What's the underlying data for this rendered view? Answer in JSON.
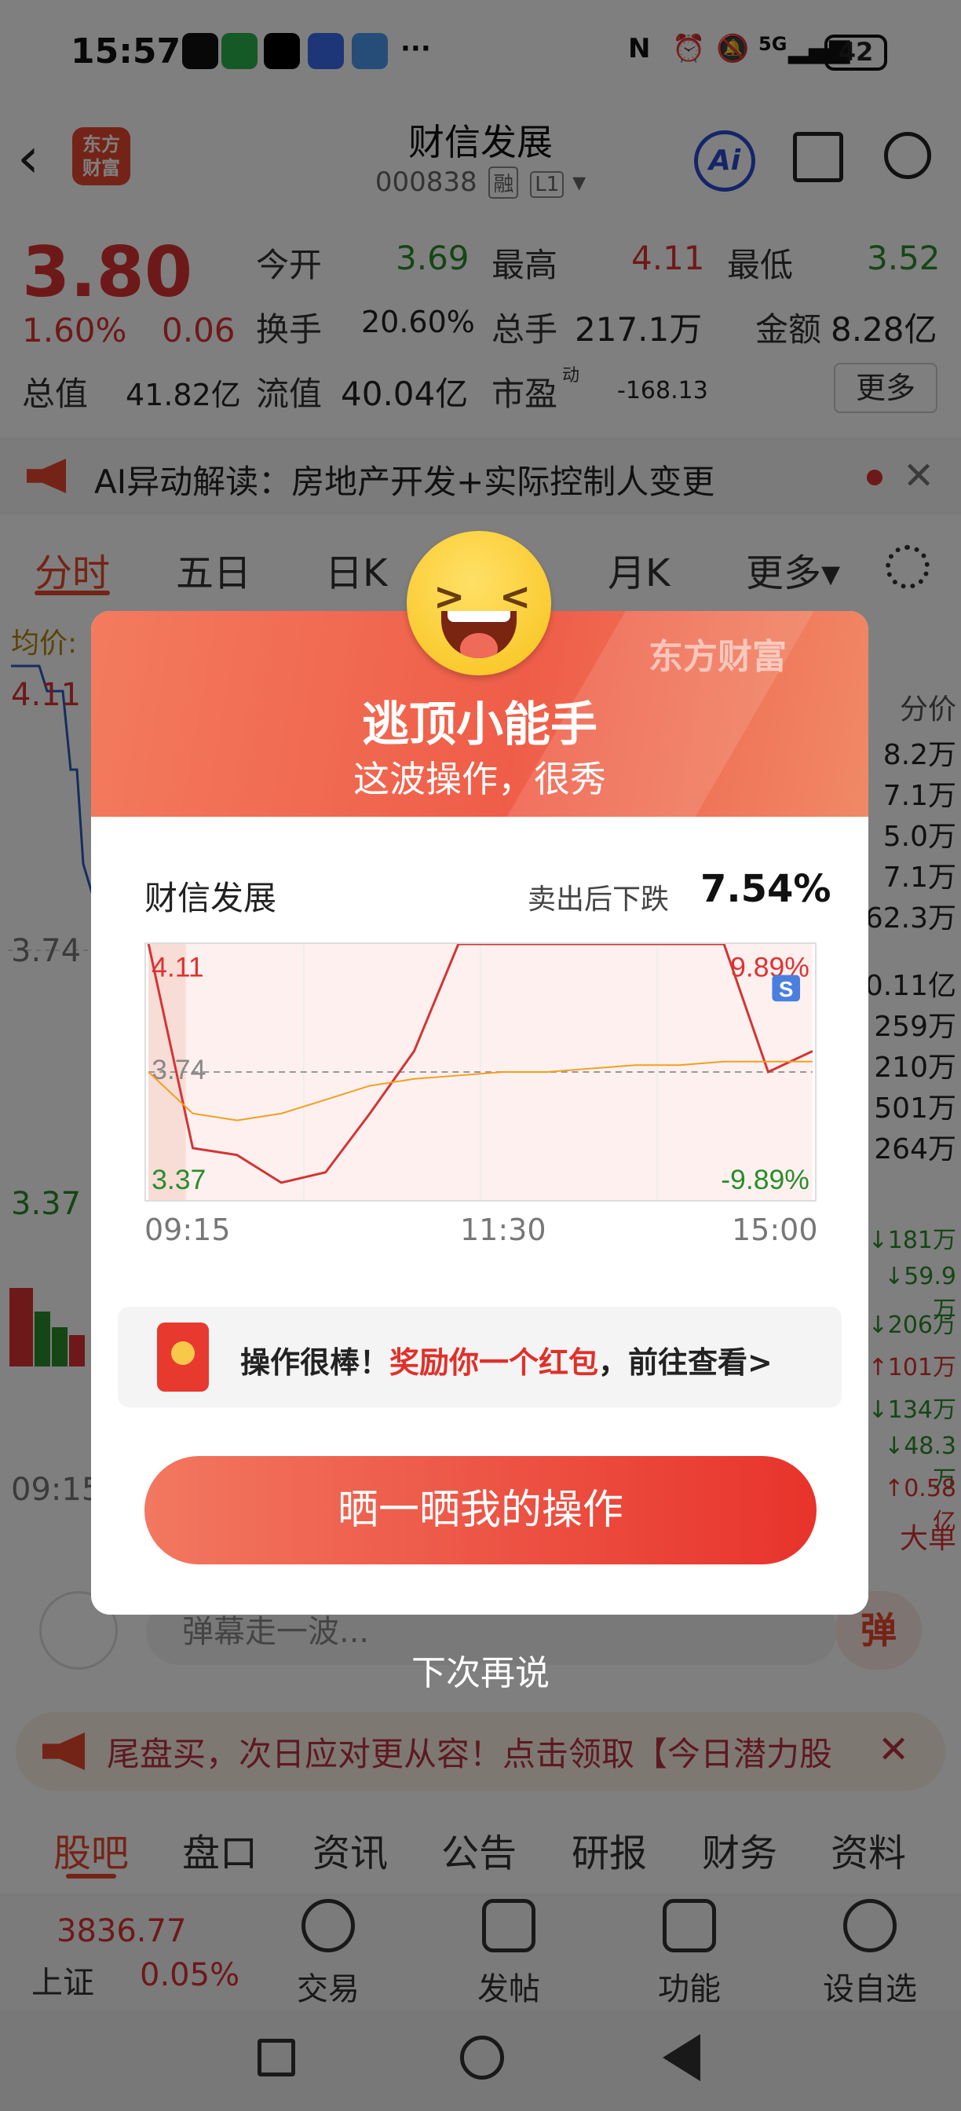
{
  "status_bar": {
    "time": "15:57",
    "network": "5G",
    "battery": "42"
  },
  "header": {
    "title": "财信发展",
    "code": "000838",
    "tags": [
      "融",
      "L1"
    ],
    "logo": "东方\n财富",
    "ai_label": "Ai"
  },
  "quote": {
    "price": "3.80",
    "pct": "1.60%",
    "change": "0.06",
    "open_label": "今开",
    "open": "3.69",
    "high_label": "最高",
    "high": "4.11",
    "low_label": "最低",
    "low": "3.52",
    "turnover_label": "换手",
    "turnover": "20.60%",
    "volume_label": "总手",
    "volume": "217.1万",
    "amount_label": "金额",
    "amount": "8.28亿",
    "mcap_label": "总值",
    "mcap": "41.82亿",
    "float_label": "流值",
    "float": "40.04亿",
    "pe_label": "市盈",
    "pe_sup": "动",
    "pe": "-168.13",
    "more": "更多"
  },
  "notice": {
    "text": "AI异动解读：房地产开发+实际控制人变更"
  },
  "chart_tabs": [
    "分时",
    "五日",
    "日K",
    "月K",
    "更多▾"
  ],
  "bg_chart": {
    "avg_label": "均价:",
    "y_top": "4.11",
    "y_mid": "3.74",
    "y_bottom": "3.37",
    "time_start": "09:15",
    "right_header": "分价",
    "right_values": [
      "8.2万",
      "7.1万",
      "5.0万",
      "7.1万",
      "62.3万",
      "0.11亿",
      "259万",
      "210万",
      "501万",
      "264万"
    ],
    "right_flows": [
      "↓181万",
      "↓59.9万",
      "↓206万",
      "↑101万",
      "↓134万",
      "↓48.3万",
      "↑0.58亿"
    ],
    "right_footer": "大单"
  },
  "comment": {
    "placeholder": "弹幕走一波...",
    "danmu": "弹"
  },
  "promo": {
    "text": "尾盘买，次日应对更从容！点击领取【今日潜力股"
  },
  "bottom_tabs": [
    "股吧",
    "盘口",
    "资讯",
    "公告",
    "研报",
    "财务",
    "资料"
  ],
  "toolbar": {
    "index_value": "3836.77",
    "index_name": "上证",
    "index_pct": "0.05%",
    "items": [
      "交易",
      "发帖",
      "功能",
      "设自选"
    ]
  },
  "modal": {
    "brand": "东方财富",
    "title": "逃顶小能手",
    "subtitle": "这波操作，很秀",
    "stock_name": "财信发展",
    "drop_label": "卖出后下跌",
    "drop_value": "7.54%",
    "y_top": "4.11",
    "y_mid": "3.74",
    "y_bottom": "3.37",
    "pct_top": "9.89%",
    "pct_bottom": "-9.89%",
    "sell_marker": "S",
    "times": [
      "09:15",
      "11:30",
      "15:00"
    ],
    "reward_prefix": "操作很棒！",
    "reward_highlight": "奖励你一个红包",
    "reward_suffix": "，前往查看>",
    "share_button": "晒一晒我的操作",
    "later": "下次再说"
  },
  "colors": {
    "accent": "#e8492f",
    "up": "#d33333",
    "down": "#2a8c2a",
    "avg": "#f0a020"
  },
  "chart_data": [
    {
      "type": "line",
      "title": "",
      "xlabel": "",
      "ylabel": "",
      "x": [
        "09:15",
        "09:30",
        "09:45",
        "10:00",
        "10:15",
        "10:30",
        "10:45",
        "11:00",
        "11:15",
        "11:30",
        "13:00",
        "14:00",
        "14:30",
        "14:45",
        "14:55",
        "15:00"
      ],
      "series": [
        {
          "values": [
            4.11,
            3.52,
            3.5,
            3.42,
            3.45,
            3.62,
            3.8,
            4.11,
            4.11,
            4.11,
            4.11,
            4.11,
            4.11,
            4.11,
            3.74,
            3.8
          ]
        },
        {
          "values": [
            3.74,
            3.62,
            3.6,
            3.62,
            3.66,
            3.7,
            3.72,
            3.73,
            3.74,
            3.74,
            3.75,
            3.76,
            3.76,
            3.77,
            3.77,
            3.77
          ]
        }
      ],
      "ylim": [
        3.37,
        4.11
      ],
      "y_ticks": [
        "4.11",
        "3.74",
        "3.37"
      ],
      "y_ticks_right": [
        "9.89%",
        "-9.89%"
      ],
      "annotations": [
        "S"
      ]
    }
  ]
}
